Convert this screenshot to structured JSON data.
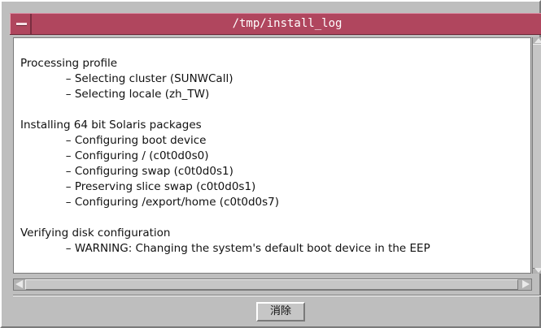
{
  "window": {
    "title": "/tmp/install_log",
    "accent_color": "#b0465e"
  },
  "log": {
    "lines": [
      "Processing profile",
      "             – Selecting cluster (SUNWCall)",
      "             – Selecting locale (zh_TW)",
      "",
      "Installing 64 bit Solaris packages",
      "             – Configuring boot device",
      "             – Configuring / (c0t0d0s0)",
      "             – Configuring swap (c0t0d0s1)",
      "             – Preserving slice swap (c0t0d0s1)",
      "             – Configuring /export/home (c0t0d0s7)",
      "",
      "Verifying disk configuration",
      "             – WARNING: Changing the system's default boot device in the EEP"
    ]
  },
  "footer": {
    "clear_label": "消除"
  }
}
